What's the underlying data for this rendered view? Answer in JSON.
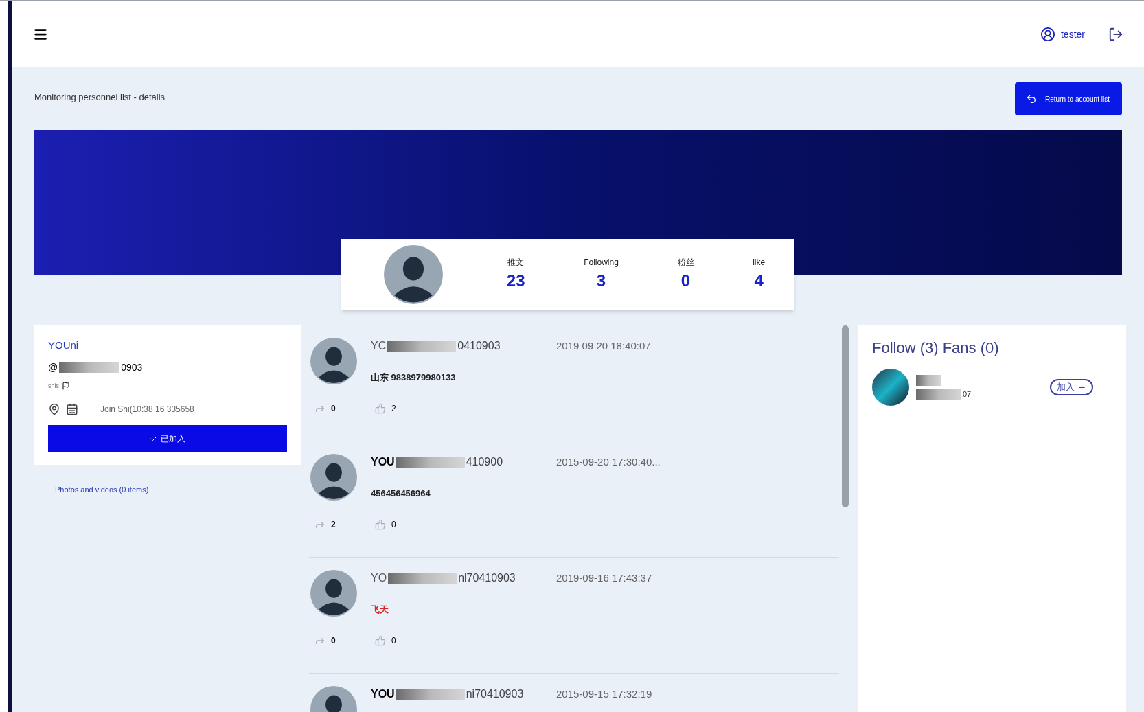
{
  "header": {
    "user": "tester"
  },
  "breadcrumb": "Monitoring personnel list - details",
  "return_button": "Return to account list",
  "stats": [
    {
      "label": "推文",
      "value": "23"
    },
    {
      "label": "Following",
      "value": "3"
    },
    {
      "label": "粉丝",
      "value": "0"
    },
    {
      "label": "like",
      "value": "4"
    }
  ],
  "profile": {
    "name": "YOUni",
    "account_prefix": "@",
    "account_suffix": "0903",
    "note": "shis",
    "joined": "Join Shi(10:38 16 335658",
    "joined_button": "已加入",
    "media_link": "Photos and videos (0 items)"
  },
  "posts": [
    {
      "name_start": "YC",
      "name_end": "0410903",
      "bold": false,
      "time": "2019 09 20 18:40:07",
      "content": "山东 9838979980133",
      "highlight": false,
      "shares": "0",
      "likes": "2"
    },
    {
      "name_start": "YOU",
      "name_end": "410900",
      "bold": true,
      "time": "2015-09-20 17:30:40...",
      "content": "456456456964",
      "highlight": false,
      "shares": "2",
      "likes": "0"
    },
    {
      "name_start": "YO",
      "name_end": "nl70410903",
      "bold": false,
      "time": "2019-09-16 17:43:37",
      "content": "飞天",
      "highlight": true,
      "shares": "0",
      "likes": "0"
    },
    {
      "name_start": "YOU",
      "name_end": "ni70410903",
      "bold": true,
      "time": "2015-09-15 17:32:19"
    }
  ],
  "follow": {
    "title": "Follow (3) Fans (0)",
    "items": [
      {
        "name_end": "07",
        "button": "加入"
      }
    ]
  }
}
